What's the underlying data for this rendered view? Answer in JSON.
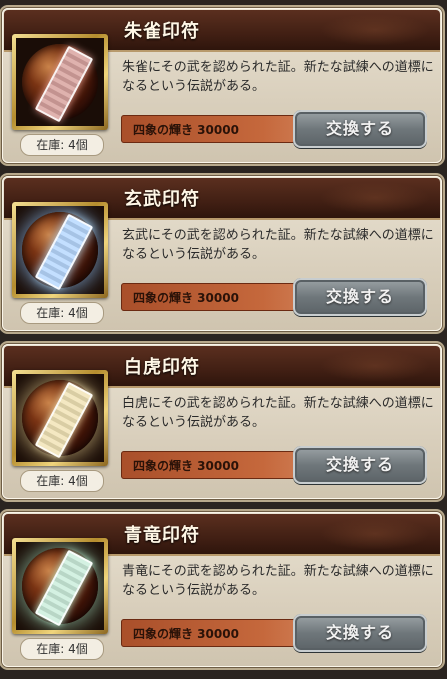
{
  "items": [
    {
      "title": "朱雀印符",
      "description": "朱雀にその武を認められた証。新たな試練への道標になるという伝説がある。",
      "cost": "四象の輝き 30000",
      "button": "交換する",
      "stock": "在庫: 4個",
      "icon": "red-talisman-icon"
    },
    {
      "title": "玄武印符",
      "description": "玄武にその武を認められた証。新たな試練への道標になるという伝説がある。",
      "cost": "四象の輝き 30000",
      "button": "交換する",
      "stock": "在庫: 4個",
      "icon": "blue-talisman-icon"
    },
    {
      "title": "白虎印符",
      "description": "白虎にその武を認められた証。新たな試練への道標になるという伝説がある。",
      "cost": "四象の輝き 30000",
      "button": "交換する",
      "stock": "在庫: 4個",
      "icon": "gold-talisman-icon"
    },
    {
      "title": "青竜印符",
      "description": "青竜にその武を認められた証。新たな試練への道標になるという伝説がある。",
      "cost": "四象の輝き 30000",
      "button": "交換する",
      "stock": "在庫: 4個",
      "icon": "green-talisman-icon"
    }
  ]
}
